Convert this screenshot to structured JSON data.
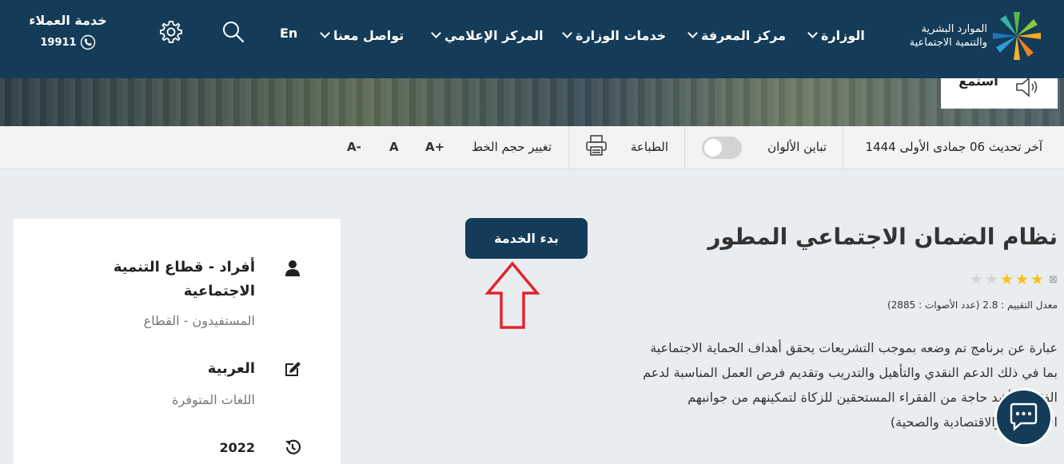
{
  "header": {
    "logo_line1": "الموارد البشرية",
    "logo_line2": "والتنمية الاجتماعية",
    "nav_items": [
      "الوزارة",
      "مركز المعرفة",
      "خدمات الوزارة",
      "المركز الإعلامي",
      "تواصل معنا"
    ],
    "lang_switch": "En",
    "customer_service_title": "خدمة العملاء",
    "customer_service_phone": "19911",
    "icons": [
      "search-icon",
      "gear-icon",
      "phone-icon",
      "chevron-down-icon"
    ]
  },
  "hero": {
    "listen_label": "استمع"
  },
  "toolbar": {
    "last_update": "آخر تحديث 06 جمادى الأولى 1444",
    "contrast_label": "تباين الألوان",
    "print_label": "الطباعة",
    "font_size_label": "تغيير حجم الخط",
    "font_increase": "A+",
    "font_reset": "A",
    "font_decrease": "A-"
  },
  "main": {
    "title": "نظام الضمان الاجتماعي المطور",
    "rating_stars_filled": 3,
    "rating_stars_total": 5,
    "rating_text": "معدل التقييم : 2.8 (عدد الأصوات : 2885)",
    "description": "عبارة عن برنامج تم وضعه بموجب التشريعات يحقق أهداف الحماية الاجتماعية بما في ذلك الدعم النقدي والتأهيل والتدريب وتقديم فرص العمل المناسبة لدعم الفئات الأشد حاجة من الفقراء المستحقين للزكاة لتمكينهم من جوانبهم الاجتماعية والاقتصادية والصحية)",
    "start_button": "بدء الخدمة"
  },
  "side_card": {
    "beneficiaries_value": "أفراد - قطاع التنمية الاجتماعية",
    "beneficiaries_label": "المستفيدون - القطاع",
    "languages_value": "العربية",
    "languages_label": "اللغات المتوفرة",
    "year_value": "2022"
  },
  "colors": {
    "header_bg": "#143c58",
    "button_bg": "#143c58",
    "star": "#f6c21a",
    "arrow": "#e3242b"
  }
}
